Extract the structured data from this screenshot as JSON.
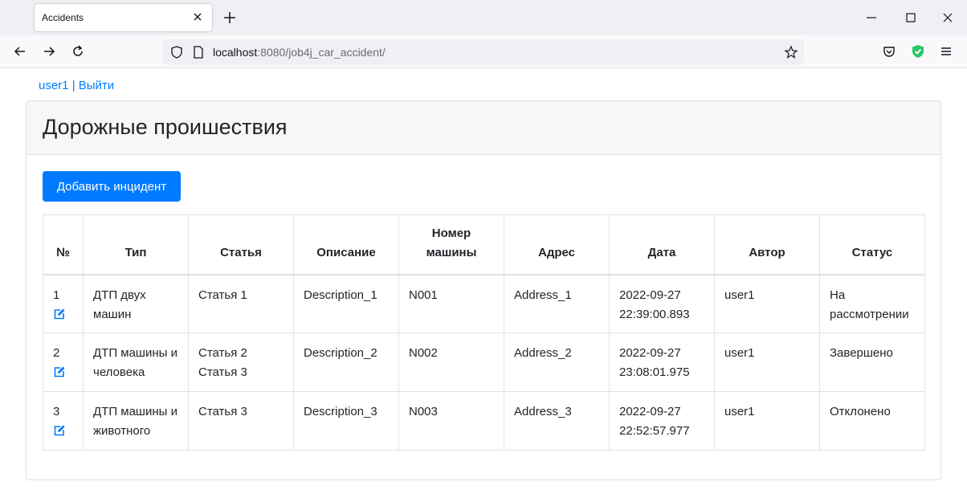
{
  "browser": {
    "tab_title": "Accidents",
    "url_host": "localhost",
    "url_rest": ":8080/job4j_car_accident/",
    "icons": {
      "tab_close": "close-icon",
      "new_tab": "plus-icon",
      "minimize": "minimize-icon",
      "maximize": "maximize-icon",
      "close_window": "close-icon",
      "back": "arrow-left-icon",
      "forward": "arrow-right-icon",
      "reload": "reload-icon",
      "shield": "shield-icon",
      "page": "page-icon",
      "bookmark": "star-icon",
      "pocket": "pocket-icon",
      "extension": "shield-check-icon",
      "menu": "hamburger-icon"
    }
  },
  "user": {
    "name": "user1",
    "separator": " | ",
    "logout": "Выйти"
  },
  "page": {
    "title": "Дорожные проишествия",
    "add_button": "Добавить инцидент"
  },
  "table": {
    "headers": [
      "№",
      "Тип",
      "Статья",
      "Описание",
      "Номер машины",
      "Адрес",
      "Дата",
      "Автор",
      "Статус"
    ],
    "rows": [
      {
        "num": "1",
        "type": "ДТП двух машин",
        "rules": "Статья 1",
        "description": "Description_1",
        "car_number": "N001",
        "address": "Address_1",
        "date": "2022-09-27 22:39:00.893",
        "author": "user1",
        "status": "На рассмотрении"
      },
      {
        "num": "2",
        "type": "ДТП машины и человека",
        "rules": "Статья 2 Статья 3",
        "description": "Description_2",
        "car_number": "N002",
        "address": "Address_2",
        "date": "2022-09-27 23:08:01.975",
        "author": "user1",
        "status": "Завершено"
      },
      {
        "num": "3",
        "type": "ДТП машины и животного",
        "rules": "Статья 3",
        "description": "Description_3",
        "car_number": "N003",
        "address": "Address_3",
        "date": "2022-09-27 22:52:57.977",
        "author": "user1",
        "status": "Отклонено"
      }
    ]
  },
  "colors": {
    "accent": "#007bff",
    "text": "#212529",
    "border": "#dee2e6",
    "card_header": "#f7f7f7"
  }
}
